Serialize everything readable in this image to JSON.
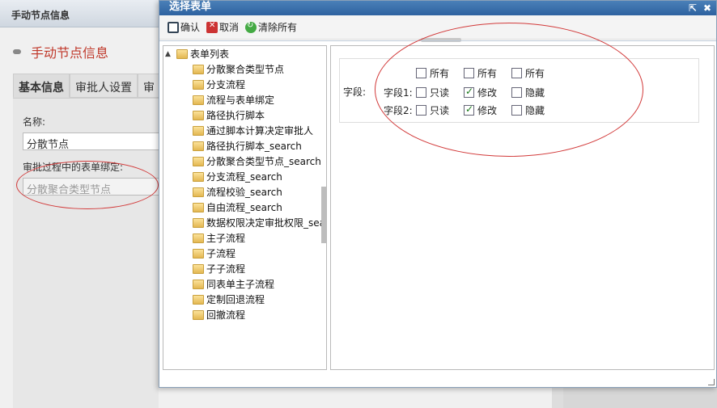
{
  "background": {
    "header_title": "手动节点信息",
    "heading": "手动节点信息",
    "tabs": [
      "基本信息",
      "审批人设置",
      "审"
    ],
    "name_label": "名称:",
    "name_value": "分散节点",
    "binding_label": "审批过程中的表单绑定:",
    "binding_value": "分散聚合类型节点"
  },
  "dialog": {
    "title": "选择表单",
    "toolbar": {
      "confirm_label": "确认",
      "cancel_label": "取消",
      "clear_label": "清除所有"
    },
    "tree": {
      "root_label": "表单列表",
      "items": [
        "分散聚合类型节点",
        "分支流程",
        "流程与表单绑定",
        "路径执行脚本",
        "通过脚本计算决定审批人",
        "路径执行脚本_search",
        "分散聚合类型节点_search",
        "分支流程_search",
        "流程校验_search",
        "自由流程_search",
        "数据权限决定审批权限_sea",
        "主子流程",
        "子流程",
        "子子流程",
        "同表单主子流程",
        "定制回退流程",
        "回撤流程"
      ]
    },
    "fields": {
      "label": "字段:",
      "header_all": [
        "所有",
        "所有",
        "所有"
      ],
      "rows": [
        {
          "name": "字段1:",
          "readonly_label": "只读",
          "readonly": false,
          "modify_label": "修改",
          "modify": true,
          "hidden_label": "隐藏",
          "hidden": false
        },
        {
          "name": "字段2:",
          "readonly_label": "只读",
          "readonly": false,
          "modify_label": "修改",
          "modify": true,
          "hidden_label": "隐藏",
          "hidden": false
        }
      ]
    }
  },
  "colors": {
    "accent_red": "#d23a3a",
    "title_blue": "#2e62a0",
    "heading_red": "#c0392b"
  }
}
